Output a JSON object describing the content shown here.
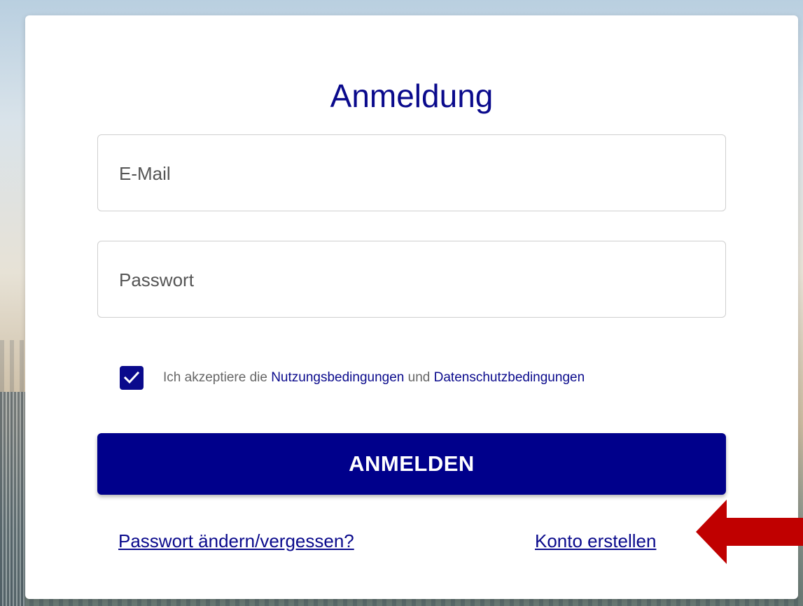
{
  "login": {
    "title": "Anmeldung",
    "email_placeholder": "E-Mail",
    "password_placeholder": "Passwort",
    "consent": {
      "checked": true,
      "prefix": "Ich akzeptiere die ",
      "terms_link": "Nutzungsbedingungen",
      "middle": " und ",
      "privacy_link": "Datenschutzbedingungen"
    },
    "submit_label": "ANMELDEN",
    "forgot_link": "Passwort ändern/vergessen?",
    "create_link": "Konto erstellen"
  },
  "colors": {
    "primary": "#00008b",
    "annotation_arrow": "#c00000"
  },
  "icons": {
    "checkbox": "checkmark-icon",
    "annotation": "arrow-left-icon"
  }
}
